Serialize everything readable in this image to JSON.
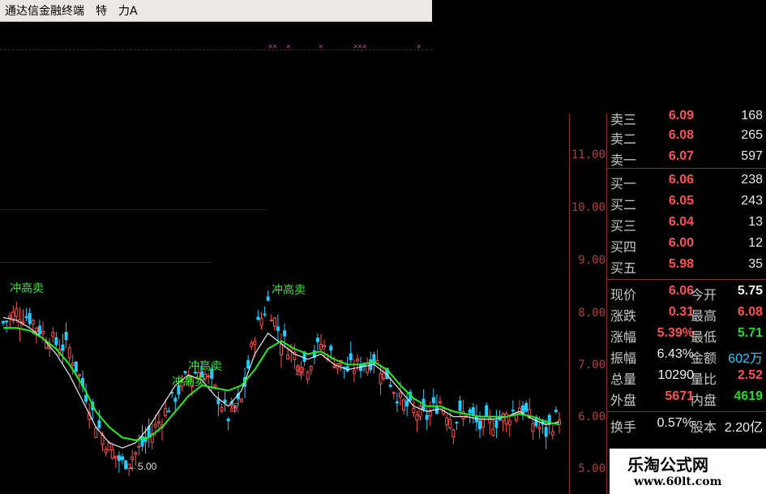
{
  "titlebar": {
    "app_name": "通达信金融终端",
    "item1": "特",
    "item2": "力A"
  },
  "top_marks": [
    "××",
    "×",
    "×",
    "×××",
    "×"
  ],
  "price_axis": {
    "ticks": [
      "11.00",
      "10.00",
      "9.00",
      "8.00",
      "7.00",
      "6.00",
      "5.00"
    ]
  },
  "annotations": {
    "chong_gao_mai_1": "冲高卖",
    "chong_gao_mai_2": "冲高卖",
    "chong_gao_mai_3": "冲高卖",
    "chong_gao_mai_4": "冲高卖",
    "gen_1": "跟",
    "gen_2": "跟",
    "low_marker": "←5.00"
  },
  "quote_panel": {
    "asks": [
      {
        "label": "卖三",
        "price": "6.09",
        "volume": "168"
      },
      {
        "label": "卖二",
        "price": "6.08",
        "volume": "265"
      },
      {
        "label": "卖一",
        "price": "6.07",
        "volume": "597"
      }
    ],
    "bids": [
      {
        "label": "买一",
        "price": "6.06",
        "volume": "238"
      },
      {
        "label": "买二",
        "price": "6.05",
        "volume": "243"
      },
      {
        "label": "买三",
        "price": "6.04",
        "volume": "13"
      },
      {
        "label": "买四",
        "price": "6.00",
        "volume": "12"
      },
      {
        "label": "买五",
        "price": "5.98",
        "volume": "35"
      }
    ],
    "stats": [
      {
        "l1": "现价",
        "v1": "6.06",
        "l2": "今开",
        "v2": "5.75"
      },
      {
        "l1": "涨跌",
        "v1": "0.31",
        "l2": "最高",
        "v2": "6.08"
      },
      {
        "l1": "涨幅",
        "v1": "5.39%",
        "l2": "最低",
        "v2": "5.71"
      },
      {
        "l1": "振幅",
        "v1": "6.43%",
        "l2": "金额",
        "v2": "602万"
      },
      {
        "l1": "总量",
        "v1": "10290",
        "l2": "量比",
        "v2": "2.52"
      },
      {
        "l1": "外盘",
        "v1": "5671",
        "l2": "内盘",
        "v2": "4619"
      },
      {
        "l1": "换手",
        "v1": "0.57%",
        "l2": "股本",
        "v2": "2.20亿"
      }
    ]
  },
  "watermark": {
    "line1": "乐淘公式网",
    "line2": "www.60lt.com"
  },
  "colors": {
    "up": "#ff5050",
    "down": "#22ccff",
    "ma_short": "#f0f0f0",
    "ma_long": "#22ee22",
    "axis": "#8a2a2a"
  },
  "chart_data": {
    "type": "candlestick",
    "y_axis_ticks": [
      11.0,
      10.0,
      9.0,
      8.0,
      7.0,
      6.0,
      5.0
    ],
    "ylim": [
      4.9,
      11.8
    ],
    "approx_close_path": [
      7.8,
      8.0,
      7.9,
      7.6,
      7.4,
      7.3,
      6.6,
      5.9,
      5.4,
      5.1,
      5.3,
      5.6,
      6.0,
      6.4,
      6.8,
      6.9,
      6.5,
      6.0,
      6.3,
      7.6,
      8.2,
      7.5,
      7.2,
      7.0,
      7.4,
      7.1,
      6.9,
      7.0,
      7.1,
      6.8,
      6.3,
      6.1,
      6.0,
      6.3,
      5.9,
      6.1,
      5.8,
      5.9,
      6.0,
      6.2,
      5.9,
      5.7,
      6.06
    ],
    "ma_short": [
      7.9,
      7.85,
      7.7,
      7.5,
      7.2,
      6.8,
      6.3,
      5.8,
      5.5,
      5.4,
      5.5,
      5.8,
      6.2,
      6.6,
      6.8,
      6.7,
      6.4,
      6.2,
      6.5,
      7.2,
      7.6,
      7.4,
      7.2,
      7.1,
      7.2,
      7.0,
      6.9,
      6.95,
      7.0,
      6.8,
      6.5,
      6.2,
      6.1,
      6.15,
      6.0,
      6.0,
      5.95,
      5.95,
      6.0,
      6.1,
      5.95,
      5.85,
      5.9
    ],
    "ma_long": [
      7.7,
      7.7,
      7.65,
      7.5,
      7.3,
      7.0,
      6.6,
      6.1,
      5.8,
      5.6,
      5.55,
      5.6,
      5.8,
      6.1,
      6.4,
      6.6,
      6.55,
      6.5,
      6.6,
      6.9,
      7.3,
      7.45,
      7.3,
      7.2,
      7.25,
      7.1,
      7.0,
      7.0,
      7.05,
      6.9,
      6.6,
      6.35,
      6.2,
      6.2,
      6.1,
      6.05,
      6.0,
      6.0,
      6.0,
      6.05,
      6.0,
      5.9,
      5.85
    ]
  }
}
